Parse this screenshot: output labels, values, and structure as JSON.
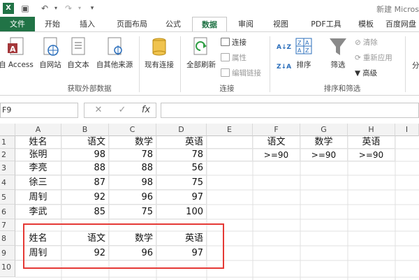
{
  "window": {
    "title": "新建 Micros"
  },
  "tabs": [
    "文件",
    "开始",
    "插入",
    "页面布局",
    "公式",
    "数据",
    "审阅",
    "视图",
    "PDF工具",
    "模板",
    "百度网盘"
  ],
  "ribbon": {
    "get_external": {
      "buttons": [
        "自 Access",
        "自网站",
        "自文本",
        "自其他来源"
      ],
      "group_label": "获取外部数据"
    },
    "existing_connections": "现有连接",
    "connections": {
      "refresh_all": "全部刷新",
      "items": [
        "连接",
        "属性",
        "编辑链接"
      ],
      "group_label": "连接"
    },
    "sort_filter": {
      "sort_az": "A↓Z",
      "sort_za": "Z↓A",
      "sort": "排序",
      "filter": "筛选",
      "items": [
        "清除",
        "重新应用",
        "高级"
      ],
      "group_label": "排序和筛选"
    },
    "cut_label": "分"
  },
  "formula_bar": {
    "name_box": "F9",
    "cancel": "✕",
    "enter": "✓",
    "fx": "fx",
    "value": ""
  },
  "columns": [
    "A",
    "B",
    "C",
    "D",
    "E",
    "F",
    "G",
    "H",
    "I"
  ],
  "rows": [
    "1",
    "2",
    "3",
    "4",
    "5",
    "6",
    "7",
    "8",
    "9",
    "10"
  ],
  "sheet": {
    "r1": [
      "姓名",
      "语文",
      "数学",
      "英语",
      "",
      "语文",
      "数学",
      "英语"
    ],
    "r2": [
      "张明",
      "98",
      "78",
      "78",
      "",
      ">=90",
      ">=90",
      ">=90"
    ],
    "r3": [
      "李亮",
      "88",
      "88",
      "56"
    ],
    "r4": [
      "徐三",
      "87",
      "98",
      "75"
    ],
    "r5": [
      "周钊",
      "92",
      "96",
      "97"
    ],
    "r6": [
      "李武",
      "85",
      "75",
      "100"
    ],
    "r8": [
      "姓名",
      "语文",
      "数学",
      "英语"
    ],
    "r9": [
      "周钊",
      "92",
      "96",
      "97"
    ]
  },
  "colors": {
    "file_tab": "#217346",
    "highlight": "#e53935"
  }
}
